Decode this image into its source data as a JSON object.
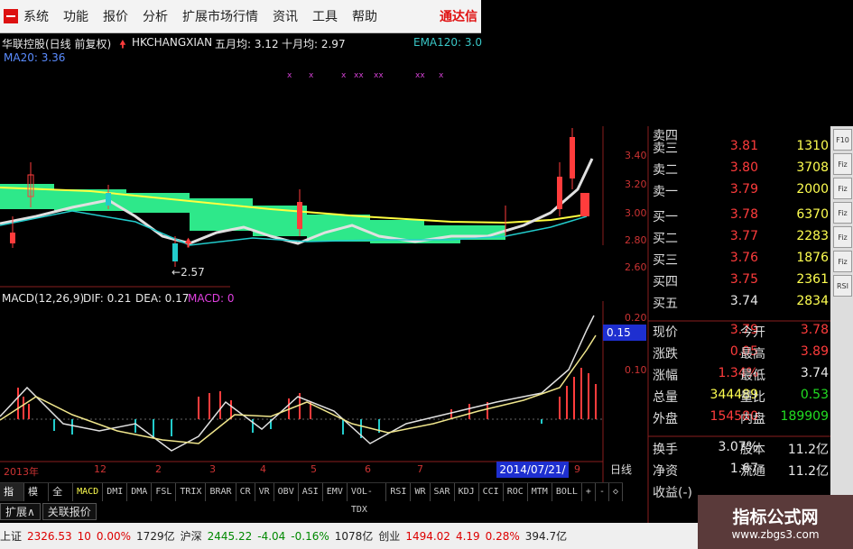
{
  "menu": {
    "items": [
      "系统",
      "功能",
      "报价",
      "分析",
      "扩展市场行情",
      "资讯",
      "工具",
      "帮助"
    ],
    "brand": "通达信"
  },
  "chart_header": {
    "stock": "华联控股(日线 前复权)",
    "symbol": "HKCHANGXIAN",
    "ma5": "五月均: 3.12",
    "ma10": "十月均: 2.97",
    "ema": "EMA120: 3.0",
    "ma20": "MA20: 3.36"
  },
  "macd_header": {
    "params": "MACD(12,26,9)",
    "dif": "DIF: 0.21",
    "dea": "DEA: 0.17",
    "macd": "MACD: 0"
  },
  "price_axis": [
    "3.40",
    "3.20",
    "3.00",
    "2.80",
    "2.60"
  ],
  "macd_axis": [
    "0.20",
    "0.10"
  ],
  "macd_current": "0.15",
  "low_marker": "2.57",
  "timeline": {
    "year": "2013年",
    "months": [
      "12",
      "2",
      "3",
      "4",
      "5",
      "6",
      "7",
      "9"
    ],
    "date": "2014/07/21/—",
    "period": "日线"
  },
  "tabs": {
    "left": [
      "指标",
      "模板",
      "全部"
    ],
    "indicators": [
      "MACD",
      "DMI",
      "DMA",
      "FSL",
      "TRIX",
      "BRAR",
      "CR",
      "VR",
      "OBV",
      "ASI",
      "EMV",
      "VOL-TDX",
      "RSI",
      "WR",
      "SAR",
      "KDJ",
      "CCI",
      "ROC",
      "MTM",
      "BOLL",
      "+",
      "-",
      "◇"
    ]
  },
  "subtabs": [
    "扩展∧",
    "关联报价"
  ],
  "orderbook": {
    "sell": [
      {
        "label": "卖三",
        "price": "3.81",
        "qty": "1310"
      },
      {
        "label": "卖二",
        "price": "3.80",
        "qty": "3708"
      },
      {
        "label": "卖一",
        "price": "3.79",
        "qty": "2000"
      }
    ],
    "buy": [
      {
        "label": "买一",
        "price": "3.78",
        "qty": "6370"
      },
      {
        "label": "买二",
        "price": "3.77",
        "qty": "2283"
      },
      {
        "label": "买三",
        "price": "3.76",
        "qty": "1876"
      },
      {
        "label": "买四",
        "price": "3.75",
        "qty": "2361"
      },
      {
        "label": "买五",
        "price": "3.74",
        "qty": "2834"
      }
    ]
  },
  "quote": [
    {
      "l1": "现价",
      "v1": "3.79",
      "l2": "今开",
      "v2": "3.78"
    },
    {
      "l1": "涨跌",
      "v1": "0.05",
      "l2": "最高",
      "v2": "3.89"
    },
    {
      "l1": "涨幅",
      "v1": "1.34%",
      "l2": "最低",
      "v2": "3.74"
    },
    {
      "l1": "总量",
      "v1": "344489",
      "l2": "量比",
      "v2": "0.53"
    },
    {
      "l1": "外盘",
      "v1": "154580",
      "l2": "内盘",
      "v2": "189909"
    }
  ],
  "quote2": [
    {
      "l1": "换手",
      "v1": "3.07%",
      "l2": "股本",
      "v2": "11.2亿"
    },
    {
      "l1": "净资",
      "v1": "1.67",
      "l2": "流通",
      "v2": "11.2亿"
    },
    {
      "l1": "收益(-)",
      "v1": "",
      "l2": "",
      "v2": ""
    }
  ],
  "status": {
    "sh_label": "上证",
    "sh_val": "2326.53",
    "sh_chg": "10",
    "sh_pct": "0.00%",
    "sh_amt": "1729亿",
    "hs_label": "沪深",
    "hs_val": "2445.22",
    "hs_chg": "-4.04",
    "hs_pct": "-0.16%",
    "hs_amt": "1078亿",
    "cy_label": "创业",
    "cy_val": "1494.02",
    "cy_chg": "4.19",
    "cy_pct": "0.28%",
    "cy_amt": "394.7亿"
  },
  "sidebar_buttons": [
    "F10",
    "Fiz",
    "Fiz",
    "Fiz",
    "Fiz",
    "Fiz",
    "RSI"
  ],
  "watermark": {
    "title": "指标公式网",
    "url": "www.zbgs3.com"
  },
  "colors": {
    "up": "#ff3c3c",
    "down": "#22cccc",
    "ma_yellow": "#ffff40",
    "ma_white": "#e0e0e0",
    "band_green": "#2ee88a"
  }
}
